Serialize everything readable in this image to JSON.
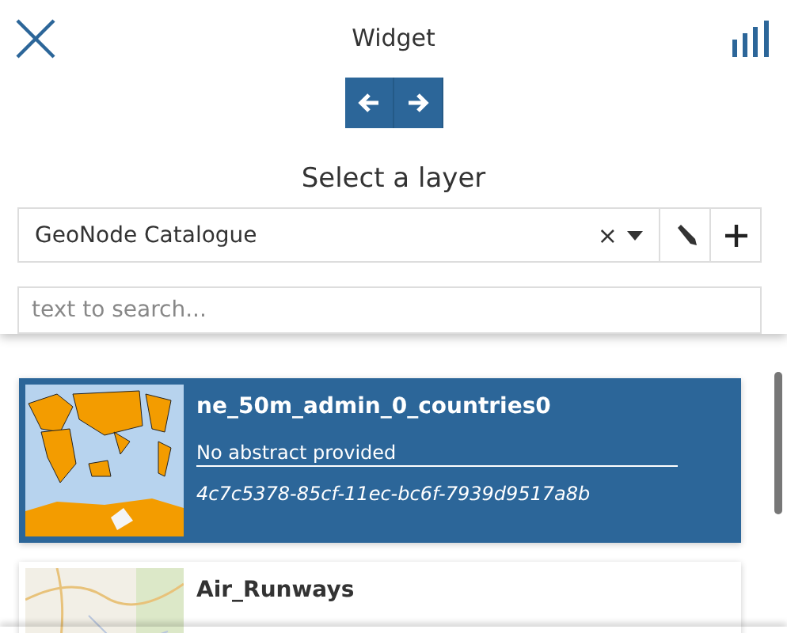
{
  "header": {
    "title": "Widget"
  },
  "prompt": "Select a layer",
  "catalog_select": {
    "value": "GeoNode Catalogue",
    "clear": "×"
  },
  "search": {
    "placeholder": "text to search..."
  },
  "layers": [
    {
      "title": "ne_50m_admin_0_countries0",
      "abstract": "No abstract provided",
      "id": "4c7c5378-85cf-11ec-bc6f-7939d9517a8b",
      "selected": true
    },
    {
      "title": "Air_Runways",
      "selected": false
    }
  ]
}
